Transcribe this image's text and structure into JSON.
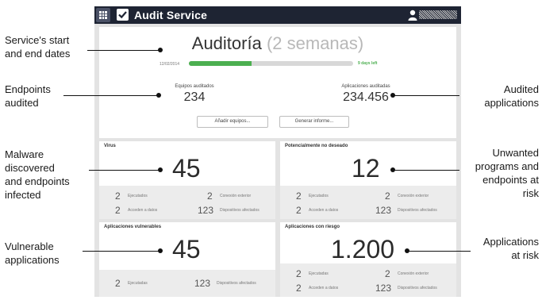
{
  "app": {
    "title": "Audit Service",
    "grid_icon": "grid-icon",
    "check_icon": "checkbox-icon",
    "user_icon": "user-icon"
  },
  "overview": {
    "title": "Auditoría",
    "subtitle": "(2 semanas)",
    "start_date": "12/02/2014",
    "progress_percent": 38,
    "days_left": "9 days left",
    "endpoints_label": "Equipos auditados",
    "endpoints_value": "234",
    "apps_label": "Aplicaciones auditadas",
    "apps_value": "234.456",
    "add_button": "Añadir equipos...",
    "report_button": "Generar informe..."
  },
  "virus": {
    "title": "Virus",
    "value": "45",
    "stats": [
      {
        "n": "2",
        "label": "Ejecutados"
      },
      {
        "n": "2",
        "label": "Conexión exterior"
      },
      {
        "n": "2",
        "label": "Acceden a datos"
      },
      {
        "n": "123",
        "label": "Dispositivos afectados"
      }
    ]
  },
  "pua": {
    "title": "Potencialmente no deseado",
    "value": "12",
    "stats": [
      {
        "n": "2",
        "label": "Ejecutados"
      },
      {
        "n": "2",
        "label": "Conexión exterior"
      },
      {
        "n": "2",
        "label": "Acceden a datos"
      },
      {
        "n": "123",
        "label": "Dispositivos afectados"
      }
    ]
  },
  "vulnerable": {
    "title": "Aplicaciones vulnerables",
    "value": "45",
    "stats": [
      {
        "n": "2",
        "label": "Ejecutadas"
      },
      {
        "n": "123",
        "label": "Dispositivos afectados"
      }
    ]
  },
  "risk": {
    "title": "Aplicaciones con riesgo",
    "value": "1.200",
    "stats": [
      {
        "n": "2",
        "label": "Ejecutadas"
      },
      {
        "n": "2",
        "label": "Conexión exterior"
      },
      {
        "n": "2",
        "label": "Acceden a datos"
      },
      {
        "n": "123",
        "label": "Dispositivos afectados"
      }
    ]
  },
  "annotations": {
    "service_dates": [
      "Service's start",
      "and end dates"
    ],
    "endpoints": [
      "Endpoints",
      "audited"
    ],
    "malware": [
      "Malware",
      "discovered",
      "and endpoints",
      "infected"
    ],
    "vulnerable": [
      "Vulnerable",
      "applications"
    ],
    "audited_apps": [
      "Audited",
      "applications"
    ],
    "unwanted": [
      "Unwanted",
      "programs and",
      "endpoints at",
      "risk"
    ],
    "apps_risk": [
      "Applications",
      "at risk"
    ]
  }
}
